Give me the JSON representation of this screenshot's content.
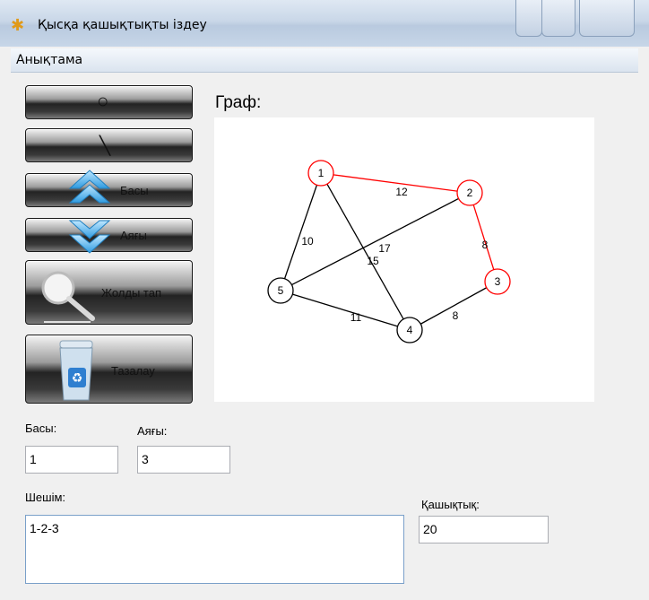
{
  "window": {
    "title": "Қысқа қашықтықты іздеу"
  },
  "menu": {
    "items": [
      {
        "label": "Анықтама"
      }
    ]
  },
  "buttons": {
    "circle_tool": {
      "symbol": "○"
    },
    "line_tool": {
      "symbol": "╲"
    },
    "start": {
      "label": "Басы"
    },
    "end": {
      "label": "Аяғы"
    },
    "find_path": {
      "label": "Жолды тап"
    },
    "clear": {
      "label": "Тазалау"
    }
  },
  "graph": {
    "title": "Граф:",
    "nodes": [
      {
        "id": "1",
        "color": "#ff0000"
      },
      {
        "id": "2",
        "color": "#ff0000"
      },
      {
        "id": "3",
        "color": "#ff0000"
      },
      {
        "id": "4",
        "color": "#000000"
      },
      {
        "id": "5",
        "color": "#000000"
      }
    ],
    "edges": [
      {
        "from": "1",
        "to": "2",
        "weight": "12",
        "color": "#ff0000"
      },
      {
        "from": "2",
        "to": "3",
        "weight": "8",
        "color": "#ff0000"
      },
      {
        "from": "1",
        "to": "5",
        "weight": "10",
        "color": "#000000"
      },
      {
        "from": "1",
        "to": "4",
        "weight": "15",
        "color": "#000000"
      },
      {
        "from": "2",
        "to": "5",
        "weight": "17",
        "color": "#000000"
      },
      {
        "from": "5",
        "to": "4",
        "weight": "11",
        "color": "#000000"
      },
      {
        "from": "4",
        "to": "3",
        "weight": "8",
        "color": "#000000"
      }
    ]
  },
  "inputs": {
    "start": {
      "label": "Басы:",
      "value": "1"
    },
    "end": {
      "label": "Аяғы:",
      "value": "3"
    },
    "solution": {
      "label": "Шешім:",
      "value": "1-2-3"
    },
    "distance": {
      "label": "Қашықтық:",
      "value": "20"
    }
  }
}
